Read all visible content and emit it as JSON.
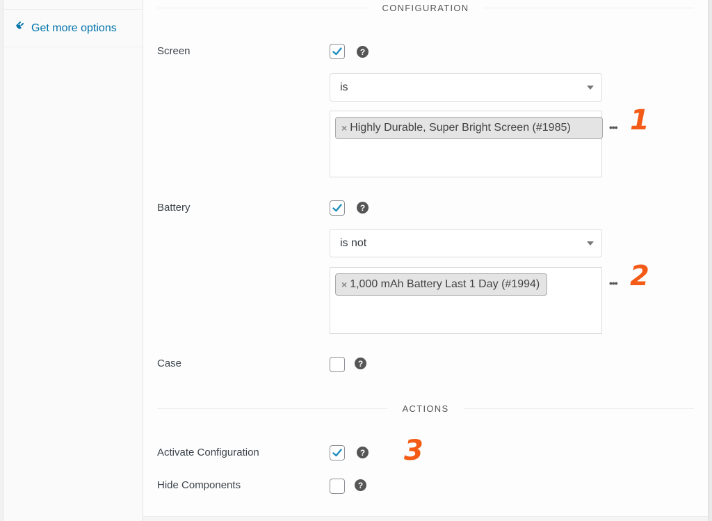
{
  "sidebar": {
    "items": [
      {
        "label": "Get more options",
        "icon": "plug-icon"
      }
    ]
  },
  "sections": {
    "configuration_title": "CONFIGURATION",
    "actions_title": "ACTIONS"
  },
  "config_rows": [
    {
      "label": "Screen",
      "checked": true,
      "condition": "is",
      "selected_items": [
        "Highly Durable, Super Bright Screen (#1985)"
      ],
      "annotation": "1"
    },
    {
      "label": "Battery",
      "checked": true,
      "condition": "is not",
      "selected_items": [
        "1,000 mAh Battery Last 1 Day (#1994)"
      ],
      "annotation": "2"
    },
    {
      "label": "Case",
      "checked": false
    }
  ],
  "actions": [
    {
      "label": "Activate Configuration",
      "checked": true
    },
    {
      "label": "Hide Components",
      "checked": false
    }
  ],
  "annotation_3": "3",
  "help_glyph": "?",
  "remove_glyph": "×",
  "more_glyph": "•••",
  "colors": {
    "link": "#0073aa",
    "checkmark": "#1e8cbe",
    "annotation": "#f35b16"
  }
}
